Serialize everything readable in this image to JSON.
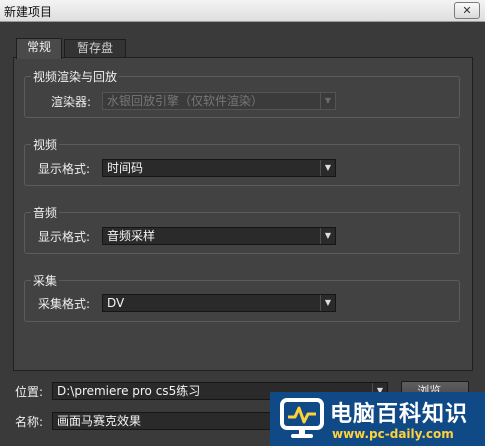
{
  "window": {
    "title": "新建项目",
    "close_glyph": "✕"
  },
  "tabs": [
    {
      "label": "常规",
      "active": true
    },
    {
      "label": "暂存盘",
      "active": false
    }
  ],
  "groups": {
    "render": {
      "title": "视频渲染与回放",
      "field_label": "渲染器:",
      "value": "水银回放引擎（仅软件渲染）",
      "disabled": true
    },
    "video": {
      "title": "视频",
      "field_label": "显示格式:",
      "value": "时间码"
    },
    "audio": {
      "title": "音频",
      "field_label": "显示格式:",
      "value": "音频采样"
    },
    "capture": {
      "title": "采集",
      "field_label": "采集格式:",
      "value": "DV"
    }
  },
  "location": {
    "label": "位置:",
    "value": "D:\\premiere pro cs5练习",
    "browse_label": "浏览..."
  },
  "project_name": {
    "label": "名称:",
    "value": "画面马赛克效果"
  },
  "watermark": {
    "title": "电脑百科知识",
    "url": "www.pc-daily.com",
    "brand_color": "#0f4a86",
    "accent_color": "#ffd23a"
  },
  "icons": {
    "dropdown": "chevron-down-icon",
    "close": "close-icon",
    "watermark": "monitor-logo-icon"
  }
}
